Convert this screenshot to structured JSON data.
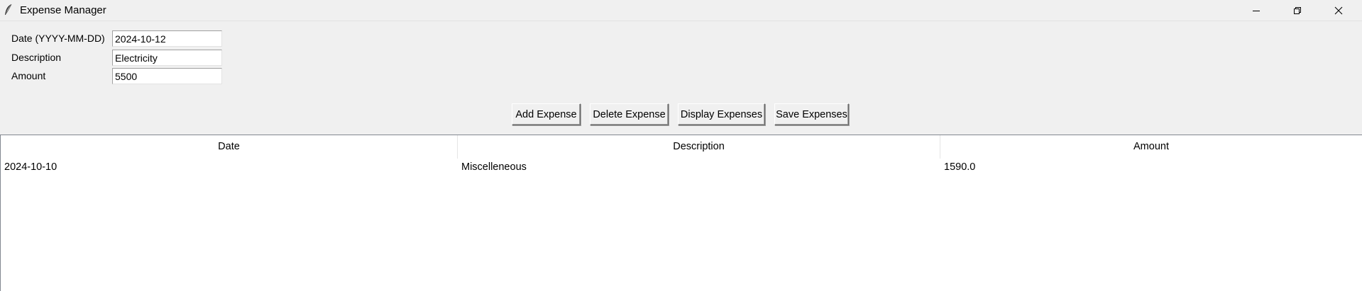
{
  "window": {
    "title": "Expense Manager",
    "icon": "feather-icon",
    "controls": {
      "minimize": "minimize-icon",
      "maximize": "restore-icon",
      "close": "close-icon"
    }
  },
  "form": {
    "date_label": "Date (YYYY-MM-DD)",
    "date_value": "2024-10-12",
    "description_label": "Description",
    "description_value": "Electricity",
    "amount_label": "Amount",
    "amount_value": "5500"
  },
  "buttons": {
    "add": "Add Expense",
    "delete": "Delete Expense",
    "display": "Display Expenses",
    "save": "Save Expenses"
  },
  "table": {
    "columns": [
      "Date",
      "Description",
      "Amount"
    ],
    "rows": [
      [
        "2024-10-10",
        "Miscelleneous",
        "1590.0"
      ]
    ]
  }
}
